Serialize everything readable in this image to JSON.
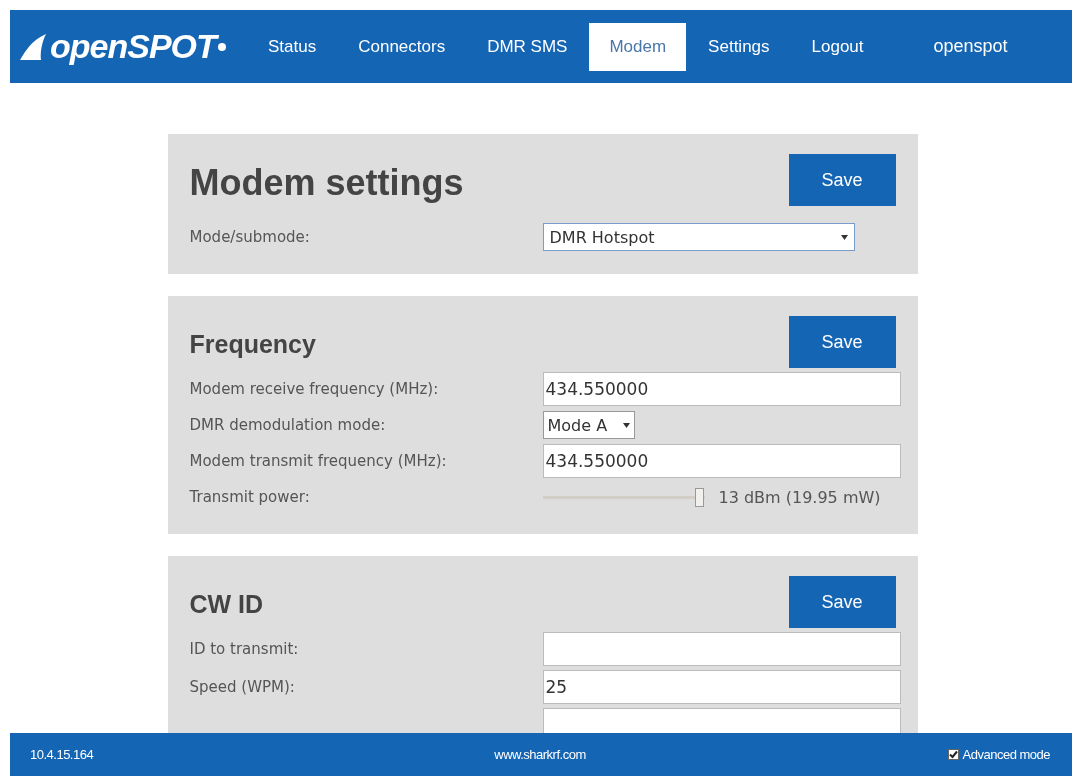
{
  "header": {
    "logo": "openSPOT",
    "nav": [
      {
        "label": "Status",
        "selected": false
      },
      {
        "label": "Connectors",
        "selected": false
      },
      {
        "label": "DMR SMS",
        "selected": false
      },
      {
        "label": "Modem",
        "selected": true
      },
      {
        "label": "Settings",
        "selected": false
      },
      {
        "label": "Logout",
        "selected": false
      }
    ],
    "user": "openspot"
  },
  "panels": [
    {
      "title": "Modem settings",
      "kind": "main",
      "save": "Save",
      "rows": [
        {
          "kind": "select",
          "label": "Mode/submode:",
          "value": "DMR Hotspot"
        }
      ]
    },
    {
      "title": "Frequency",
      "kind": "section",
      "save": "Save",
      "rows": [
        {
          "kind": "input",
          "label": "Modem receive frequency (MHz):",
          "value": "434.550000"
        },
        {
          "kind": "select-small",
          "label": "DMR demodulation mode:",
          "value": "Mode A"
        },
        {
          "kind": "input",
          "label": "Modem transmit frequency (MHz):",
          "value": "434.550000"
        },
        {
          "kind": "slider",
          "label": "Transmit power:",
          "level": 0.97,
          "reading": "13 dBm (19.95 mW)"
        }
      ]
    },
    {
      "title": "CW ID",
      "kind": "section",
      "save": "Save",
      "rows": [
        {
          "kind": "input",
          "label": "ID to transmit:",
          "value": ""
        },
        {
          "kind": "input",
          "label": "Speed (WPM):",
          "value": "25"
        },
        {
          "kind": "input",
          "label": "",
          "value": ""
        }
      ]
    }
  ],
  "footer": {
    "ip": "10.4.15.164",
    "website": "www.sharkrf.com",
    "advanced_mode": {
      "label": "Advanced mode",
      "checked": true
    }
  }
}
